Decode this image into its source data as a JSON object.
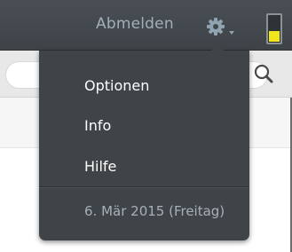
{
  "header": {
    "logout_label": "Abmelden",
    "settings_icon": "gear-icon",
    "battery_level": 0.45,
    "battery_color": "#f1e61c"
  },
  "search": {
    "icon": "search-icon"
  },
  "dropdown": {
    "items": [
      {
        "label": "Optionen"
      },
      {
        "label": "Info"
      },
      {
        "label": "Hilfe"
      }
    ],
    "date_text": "6. Mär 2015 (Freitag)"
  }
}
